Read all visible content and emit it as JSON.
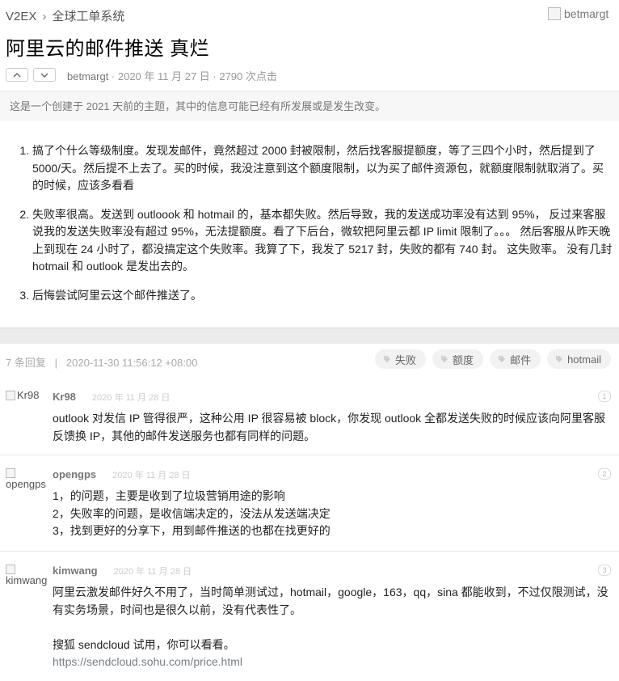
{
  "header": {
    "site": "V2EX",
    "node": "全球工单系统",
    "author_avatar_alt": "betmargt",
    "title": "阿里云的邮件推送 真烂",
    "author": "betmargt",
    "meta_rest": " · 2020 年 11 月 27 日 · 2790 次点击",
    "notice": "这是一个创建于 2021 天前的主题，其中的信息可能已经有所发展或是发生改变。"
  },
  "content": {
    "items": [
      "搞了个什么等级制度。发现发邮件，竟然超过 2000 封被限制，然后找客服提额度，等了三四个小时，然后提到了 5000/天。然后提不上去了。买的时候，我没注意到这个额度限制，以为买了邮件资源包，就额度限制就取消了。买的时候，应该多看看",
      "失败率很高。发送到 outloook 和 hotmail 的，基本都失败。然后导致，我的发送成功率没有达到 95%， 反过来客服说我的发送失败率没有超过 95%，无法提额度。看了下后台，微软把阿里云都 IP limit 限制了。。。 然后客服从昨天晚上到现在 24 小时了，都没搞定这个失败率。我算了下，我发了 5217 封，失败的都有 740 封。 这失败率。 没有几封 hotmail 和 outlook 是发出去的。",
      "后悔尝试阿里云这个邮件推送了。"
    ]
  },
  "replies_header": {
    "count": "7 条回复",
    "date": "2020-11-30 11:56:12 +08:00",
    "tags": [
      "失败",
      "额度",
      "邮件",
      "hotmail"
    ]
  },
  "replies": [
    {
      "avatar_alt": "Kr98",
      "user": "Kr98",
      "time": "2020 年 11 月 28 日",
      "num": "1",
      "lines": [
        "outlook 对发信 IP 管得很严，这种公用 IP 很容易被 block，你发现 outlook 全都发送失败的时候应该向阿里客服反馈换 IP，其他的邮件发送服务也都有同样的问题。"
      ]
    },
    {
      "avatar_alt": "opengps",
      "user": "opengps",
      "time": "2020 年 11 月 28 日",
      "num": "2",
      "lines": [
        "1，的问题，主要是收到了垃圾营销用途的影响",
        "2，失败率的问题，是收信端决定的，没法从发送端决定",
        "3，找到更好的分享下，用到邮件推送的也都在找更好的"
      ]
    },
    {
      "avatar_alt": "kimwang",
      "user": "kimwang",
      "time": "2020 年 11 月 28 日",
      "num": "3",
      "lines": [
        "阿里云激发邮件好久不用了，当时简单测试过，hotmail，google，163，qq，sina 都能收到，不过仅限测试，没有实务场景，时间也是很久以前，没有代表性了。",
        "",
        "搜狐 sendcloud 试用，你可以看看。",
        "https://sendcloud.sohu.com/price.html"
      ]
    }
  ]
}
